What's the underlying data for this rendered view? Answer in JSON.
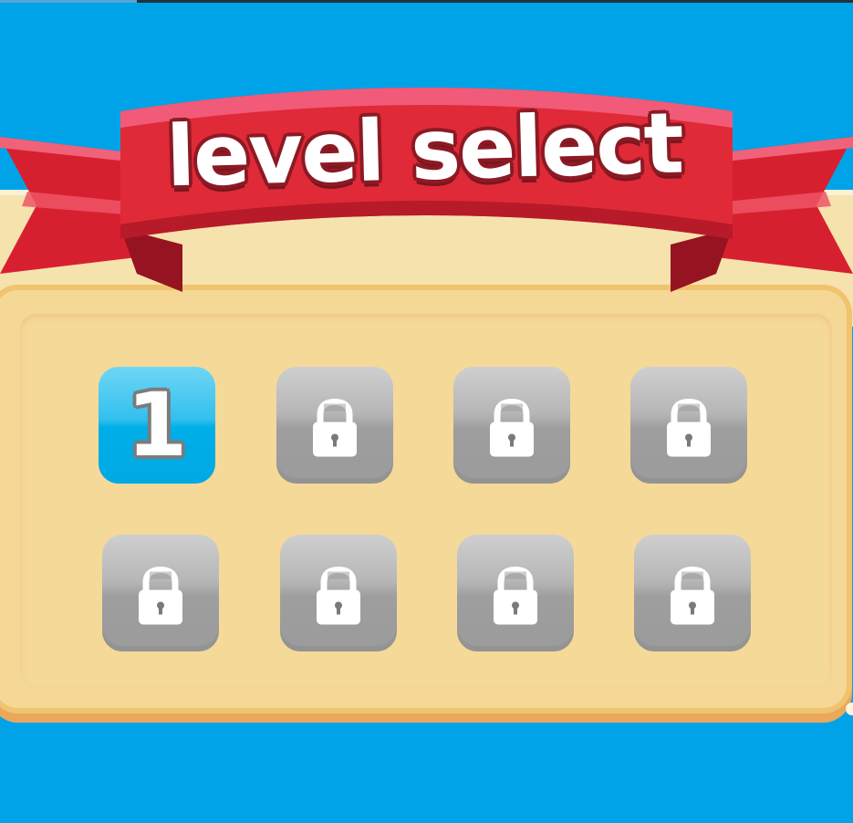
{
  "screen": {
    "title": "level select"
  },
  "levels": [
    {
      "label": "1",
      "locked": false
    },
    {
      "label": "",
      "locked": true
    },
    {
      "label": "",
      "locked": true
    },
    {
      "label": "",
      "locked": true
    },
    {
      "label": "",
      "locked": true
    },
    {
      "label": "",
      "locked": true
    },
    {
      "label": "",
      "locked": true
    },
    {
      "label": "",
      "locked": true
    }
  ],
  "colors": {
    "background": "#00a3e8",
    "panel": "#f5d895",
    "ribbon": "#e02a37",
    "tile_unlocked": "#00aee8",
    "tile_locked": "#9e9e9e"
  },
  "icons": {
    "locked_tile": "padlock-icon"
  }
}
